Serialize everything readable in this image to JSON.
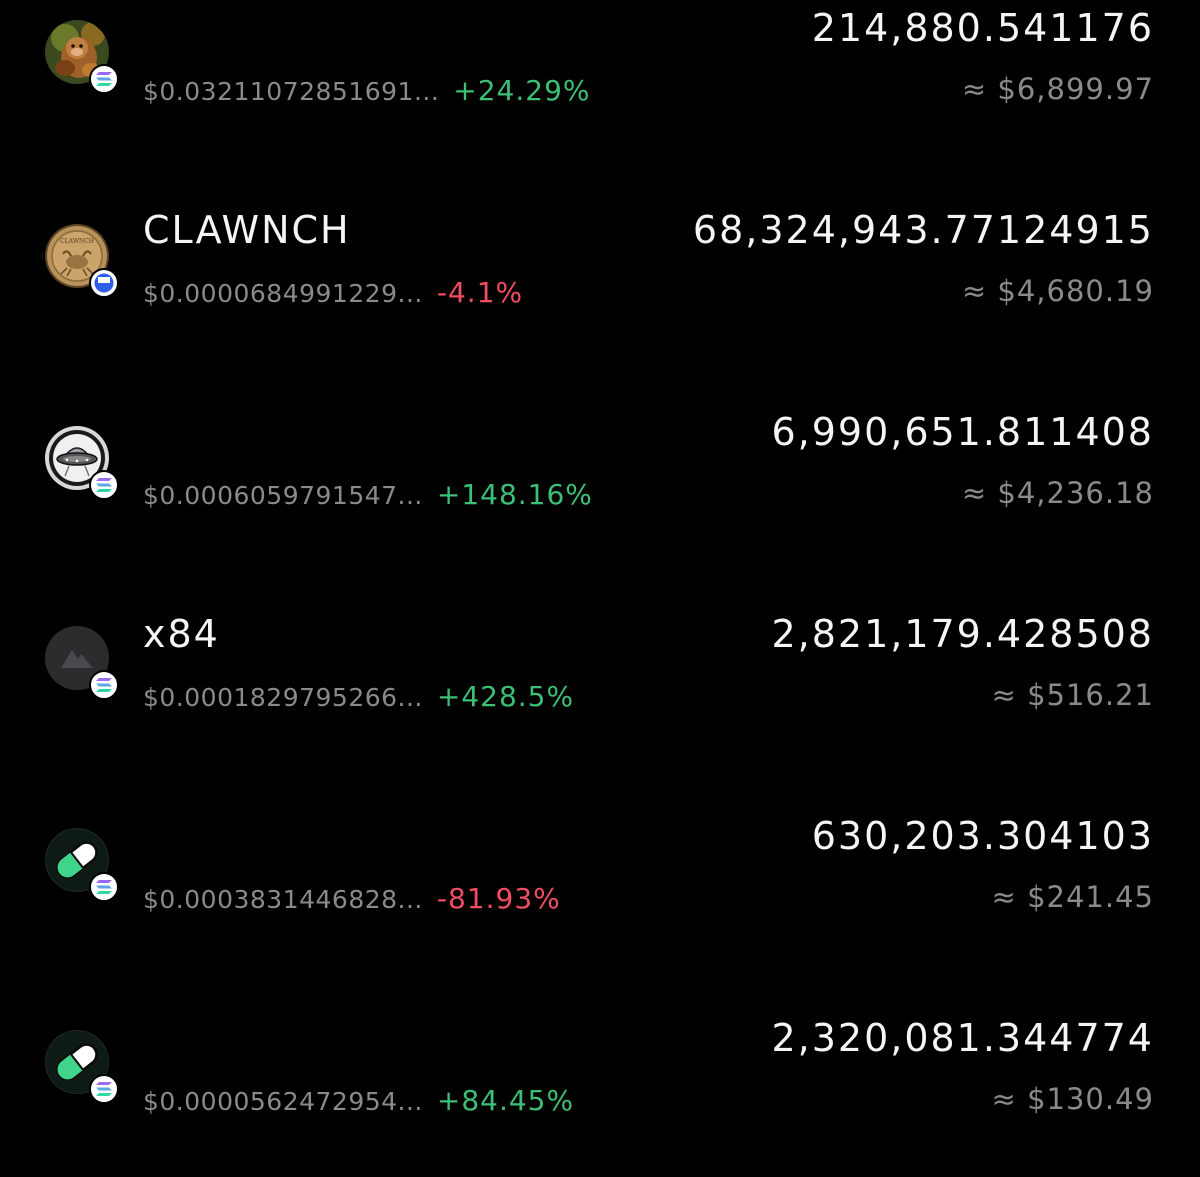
{
  "tokens": [
    {
      "name": "",
      "icon": "monkey-token-icon",
      "chain": "solana-icon",
      "price": "$0.03211072851691...",
      "change": "+24.29%",
      "direction": "up",
      "balance": "214,880.541176",
      "value": "≈ $6,899.97"
    },
    {
      "name": "CLAWNCH",
      "icon": "gold-coin-icon",
      "chain": "base-icon",
      "price": "$0.0000684991229...",
      "change": "-4.1%",
      "direction": "down",
      "balance": "68,324,943.77124915",
      "value": "≈ $4,680.19"
    },
    {
      "name": "",
      "icon": "ufo-token-icon",
      "chain": "solana-icon",
      "price": "$0.0006059791547...",
      "change": "+148.16%",
      "direction": "up",
      "balance": "6,990,651.811408",
      "value": "≈ $4,236.18"
    },
    {
      "name": "x84",
      "icon": "placeholder-token-icon",
      "chain": "solana-icon",
      "price": "$0.0001829795266...",
      "change": "+428.5%",
      "direction": "up",
      "balance": "2,821,179.428508",
      "value": "≈ $516.21"
    },
    {
      "name": "",
      "icon": "pill-token-icon",
      "chain": "solana-icon",
      "price": "$0.0003831446828...",
      "change": "-81.93%",
      "direction": "down",
      "balance": "630,203.304103",
      "value": "≈ $241.45"
    },
    {
      "name": "",
      "icon": "pill-token-icon",
      "chain": "solana-icon",
      "price": "$0.0000562472954...",
      "change": "+84.45%",
      "direction": "up",
      "balance": "2,320,081.344774",
      "value": "≈ $130.49"
    }
  ],
  "colors": {
    "background": "#000000",
    "positive": "#3cbf76",
    "negative": "#ef4e62",
    "primary_text": "#f5f5f5",
    "secondary_text": "#8a8a8e"
  }
}
